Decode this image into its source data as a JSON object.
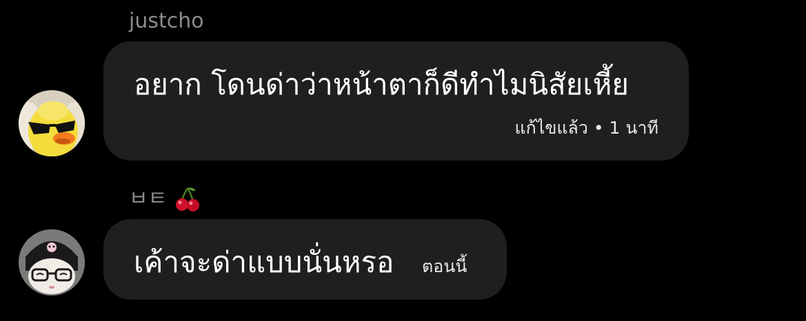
{
  "messages": [
    {
      "sender": "justcho",
      "text": "อยาก โดนด่าว่าหน้าตาก็ดีทำไมนิสัยเหี้ย",
      "meta": "แก้ไขแล้ว • 1 นาที",
      "avatar": "duck-sunglasses-avatar"
    },
    {
      "sender": "ㅂㅌ",
      "sender_emoji": "cherry-icon",
      "text": "เค้าจะด่าแบบนั่นหรอ",
      "meta": "ตอนนี้",
      "avatar": "kuromi-plush-avatar"
    }
  ],
  "colors": {
    "background": "#000000",
    "bubble": "#1f1f21",
    "sender": "#8a8a8f",
    "text": "#ffffff"
  }
}
